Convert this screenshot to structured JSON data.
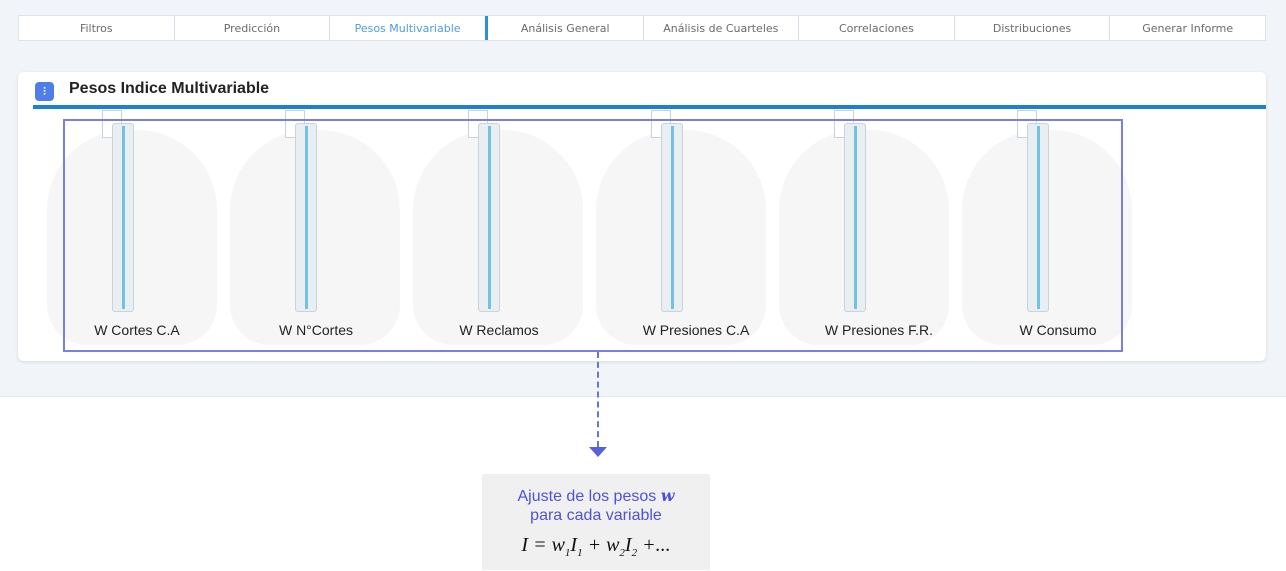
{
  "tabs": [
    {
      "label": "Filtros"
    },
    {
      "label": "Predicción"
    },
    {
      "label": "Pesos Multivariable"
    },
    {
      "label": "Análisis General"
    },
    {
      "label": "Análisis de Cuarteles"
    },
    {
      "label": "Correlaciones"
    },
    {
      "label": "Distribuciones"
    },
    {
      "label": "Generar Informe"
    }
  ],
  "active_tab": "Pesos Multivariable",
  "card": {
    "title": "Pesos Indice Multivariable",
    "icon": "sliders-icon"
  },
  "sliders": [
    {
      "label": "W Cortes C.A"
    },
    {
      "label": "W N°Cortes"
    },
    {
      "label": "W Reclamos"
    },
    {
      "label": "W Presiones C.A"
    },
    {
      "label": "W Presiones F.R."
    },
    {
      "label": "W Consumo"
    }
  ],
  "callout": {
    "line1": "Ajuste de los pesos",
    "symbol": "w",
    "line2": "para cada variable",
    "formula": {
      "lhs": "I",
      "w": "w",
      "I": "I",
      "sub1": "1",
      "sub2": "2",
      "tail": "+..."
    }
  },
  "colors": {
    "accent": "#1d80d0",
    "active_tab_text": "#4d9de0",
    "annotation": "#5a61d6",
    "slider_fill": "#72c3e3"
  }
}
